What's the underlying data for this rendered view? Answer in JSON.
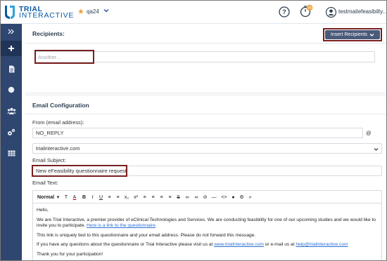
{
  "header": {
    "logo_line1": "TRIAL",
    "logo_line2": "INTERACTIVE",
    "project": "qa24",
    "timer_badge": "74",
    "user": "testmailefeasibilty..."
  },
  "colors": {
    "sidebar": "#2e4670",
    "accent": "#0b5aa5",
    "button": "#4a5a7a",
    "highlight": "#7a1f1f"
  },
  "sidebar": {
    "items": [
      {
        "icon": "double-chevron-right-icon"
      },
      {
        "icon": "plus-icon"
      },
      {
        "icon": "document-icon"
      },
      {
        "icon": "circle-icon"
      },
      {
        "icon": "users-icon"
      },
      {
        "icon": "gears-icon"
      },
      {
        "icon": "table-icon"
      }
    ]
  },
  "recipients": {
    "title": "Recipients:",
    "insert_button": "Insert Recipients",
    "input_placeholder": "Another..."
  },
  "email": {
    "title": "Email Configuration",
    "from_label": "From (email address):",
    "from_value": "NO_REPLY",
    "at_sign": "@",
    "domain_value": "trialinteractive.com",
    "subject_label": "Email Subject:",
    "subject_value": "New eFeasibility questionnaire request",
    "text_label": "Email Text:",
    "toolbar": {
      "format": "Normal",
      "buttons": [
        "T",
        "A",
        "B",
        "I",
        "U",
        "≡",
        "≡",
        "x₂",
        "x²",
        "≡",
        "≡",
        "≡",
        "≡",
        "S",
        "∞",
        "∞",
        "⊘",
        "—",
        "<>",
        "●",
        "⚙",
        "»"
      ]
    },
    "body": {
      "greeting": "Hello,",
      "p1": "We are Trial Interactive, a premier provider of eClinical Technologies and Services. We are conducting feasibility for one of our upcoming studies and we would like to invite you to participate.",
      "p1_link": "Here is a link to the questionnaire",
      "p2": "This link is uniquely tied to this questionnaire and your email address. Please do not forward this message.",
      "p3_a": "If you have any questions about the questionnaire or Trial Interactive please visit us at",
      "p3_link1": "www.trialinteractive.com",
      "p3_b": "or e-mail us at",
      "p3_link2": "help@trialinteractive.com",
      "p4": "Thank you for your participation!"
    }
  }
}
